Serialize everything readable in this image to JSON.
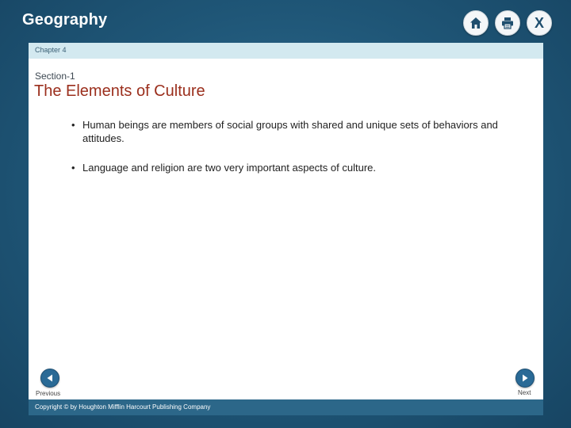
{
  "header": {
    "app_title": "Geography",
    "buttons": [
      {
        "icon": "home-icon"
      },
      {
        "icon": "print-icon"
      },
      {
        "icon": "close-icon",
        "glyph": "X"
      }
    ]
  },
  "content": {
    "chapter": "Chapter 4",
    "section": "Section-1",
    "title": "The Elements of Culture",
    "bullets": [
      "Human beings are members of social groups with shared and unique sets of behaviors and attitudes.",
      "Language and religion are two very important aspects of culture."
    ]
  },
  "nav": {
    "previous_label": "Previous",
    "next_label": "Next"
  },
  "footer": {
    "copyright": "Copyright © by Houghton Mifflin Harcourt Publishing Company"
  },
  "colors": {
    "frame": "#1f5677",
    "chapter_bar": "#d3e9f0",
    "title": "#9b2f1d",
    "footer_bar": "#2c6789",
    "nav_button": "#2a6a96"
  }
}
